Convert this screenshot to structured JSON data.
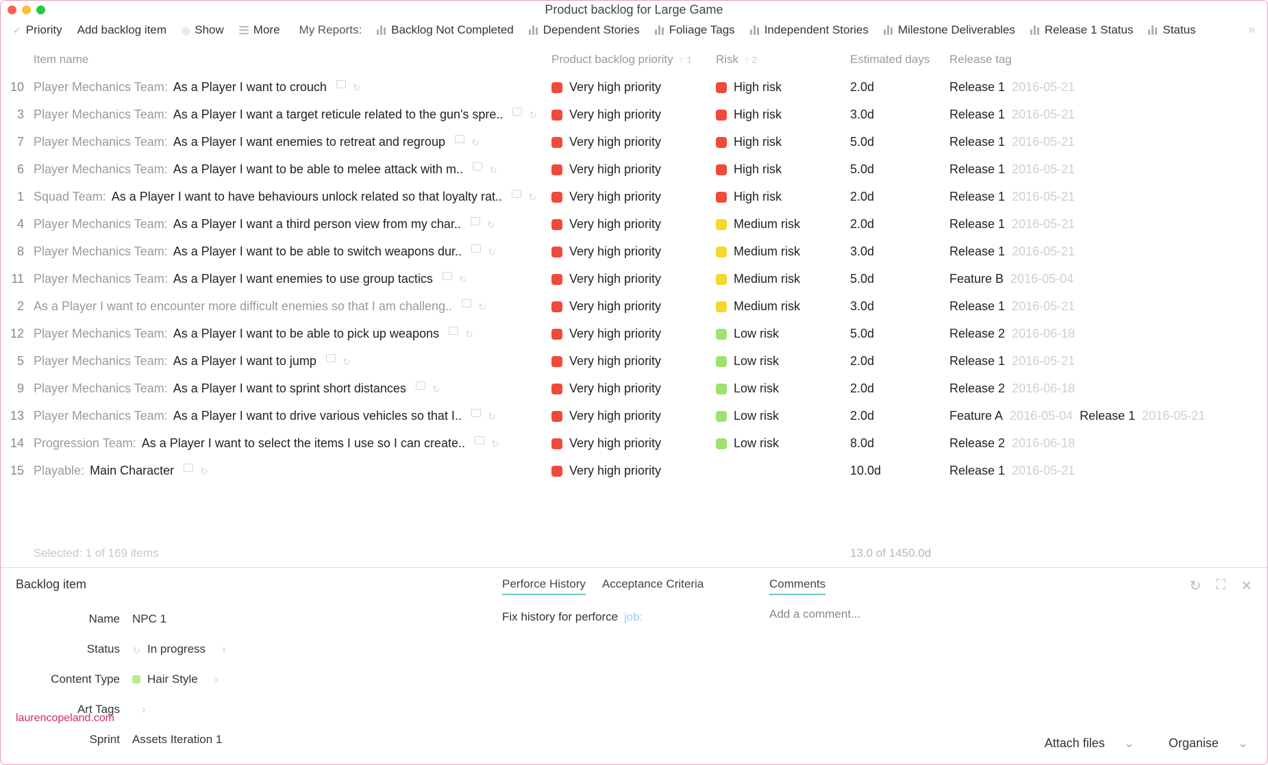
{
  "window_title": "Product backlog for Large Game",
  "toolbar": {
    "priority": "Priority",
    "add": "Add backlog item",
    "show": "Show",
    "more": "More",
    "my_reports": "My Reports:",
    "reports": [
      "Backlog Not Completed",
      "Dependent Stories",
      "Foliage Tags",
      "Independent Stories",
      "Milestone Deliverables",
      "Release 1 Status",
      "Status"
    ]
  },
  "columns": {
    "name": "Item name",
    "priority": "Product backlog priority",
    "priority_sort": "↑ 1",
    "risk": "Risk",
    "risk_sort": "↑ 2",
    "est": "Estimated days",
    "tag": "Release tag"
  },
  "rows": [
    {
      "id": "10",
      "team": "Player Mechanics Team:",
      "story": "As a Player I want to crouch",
      "priority": "Very high priority",
      "risk": "High risk",
      "riskc": "red",
      "est": "2.0d",
      "tags": [
        {
          "name": "Release 1",
          "date": "2016-05-21"
        }
      ]
    },
    {
      "id": "3",
      "team": "Player Mechanics Team:",
      "story": "As a Player I want a target reticule related to the gun's spre..",
      "priority": "Very high priority",
      "risk": "High risk",
      "riskc": "red",
      "est": "3.0d",
      "tags": [
        {
          "name": "Release 1",
          "date": "2016-05-21"
        }
      ]
    },
    {
      "id": "7",
      "team": "Player Mechanics Team:",
      "story": "As a Player I want enemies to retreat and regroup",
      "priority": "Very high priority",
      "risk": "High risk",
      "riskc": "red",
      "est": "5.0d",
      "tags": [
        {
          "name": "Release 1",
          "date": "2016-05-21"
        }
      ]
    },
    {
      "id": "6",
      "team": "Player Mechanics Team:",
      "story": "As a Player I want to be able to melee attack with m..",
      "priority": "Very high priority",
      "risk": "High risk",
      "riskc": "red",
      "est": "5.0d",
      "tags": [
        {
          "name": "Release 1",
          "date": "2016-05-21"
        }
      ]
    },
    {
      "id": "1",
      "team": "Squad Team:",
      "story": "As a Player I want to have behaviours unlock related so that loyalty rat..",
      "priority": "Very high priority",
      "risk": "High risk",
      "riskc": "red",
      "est": "2.0d",
      "tags": [
        {
          "name": "Release 1",
          "date": "2016-05-21"
        }
      ]
    },
    {
      "id": "4",
      "team": "Player Mechanics Team:",
      "story": "As a Player I want a third person view from my char..",
      "priority": "Very high priority",
      "risk": "Medium risk",
      "riskc": "yellow",
      "est": "2.0d",
      "tags": [
        {
          "name": "Release 1",
          "date": "2016-05-21"
        }
      ]
    },
    {
      "id": "8",
      "team": "Player Mechanics Team:",
      "story": "As a Player I want to be able to switch weapons dur..",
      "priority": "Very high priority",
      "risk": "Medium risk",
      "riskc": "yellow",
      "est": "3.0d",
      "tags": [
        {
          "name": "Release 1",
          "date": "2016-05-21"
        }
      ]
    },
    {
      "id": "11",
      "team": "Player Mechanics Team:",
      "story": "As a Player I want enemies to use group tactics",
      "priority": "Very high priority",
      "risk": "Medium risk",
      "riskc": "yellow",
      "est": "5.0d",
      "tags": [
        {
          "name": "Feature B",
          "date": "2016-05-04"
        }
      ]
    },
    {
      "id": "2",
      "team": "",
      "story": "As a Player I want to encounter more difficult enemies so that I am challeng..",
      "story_grey": true,
      "priority": "Very high priority",
      "risk": "Medium risk",
      "riskc": "yellow",
      "est": "3.0d",
      "tags": [
        {
          "name": "Release 1",
          "date": "2016-05-21"
        }
      ]
    },
    {
      "id": "12",
      "team": "Player Mechanics Team:",
      "story": "As a Player I want to be able to pick up weapons",
      "priority": "Very high priority",
      "risk": "Low risk",
      "riskc": "green",
      "est": "5.0d",
      "tags": [
        {
          "name": "Release 2",
          "date": "2016-06-18"
        }
      ]
    },
    {
      "id": "5",
      "team": "Player Mechanics Team:",
      "story": "As a Player I want to jump",
      "priority": "Very high priority",
      "risk": "Low risk",
      "riskc": "green",
      "est": "2.0d",
      "tags": [
        {
          "name": "Release 1",
          "date": "2016-05-21"
        }
      ]
    },
    {
      "id": "9",
      "team": "Player Mechanics Team:",
      "story": "As a Player I want to sprint short distances",
      "priority": "Very high priority",
      "risk": "Low risk",
      "riskc": "green",
      "est": "2.0d",
      "tags": [
        {
          "name": "Release 2",
          "date": "2016-06-18"
        }
      ]
    },
    {
      "id": "13",
      "team": "Player Mechanics Team:",
      "story": "As a Player I want to drive various vehicles so that I..",
      "priority": "Very high priority",
      "risk": "Low risk",
      "riskc": "green",
      "est": "2.0d",
      "tags": [
        {
          "name": "Feature A",
          "date": "2016-05-04"
        },
        {
          "name": "Release 1",
          "date": "2016-05-21"
        }
      ]
    },
    {
      "id": "14",
      "team": "Progression Team:",
      "story": "As a Player I want to select the items I use so I can create..",
      "priority": "Very high priority",
      "risk": "Low risk",
      "riskc": "green",
      "est": "8.0d",
      "tags": [
        {
          "name": "Release 2",
          "date": "2016-06-18"
        }
      ]
    },
    {
      "id": "15",
      "team": "Playable:",
      "story": "Main Character",
      "priority": "Very high priority",
      "risk": "",
      "riskc": "",
      "est": "10.0d",
      "tags": [
        {
          "name": "Release 1",
          "date": "2016-05-21"
        }
      ]
    }
  ],
  "footer": {
    "selected": "Selected: 1 of 169 items",
    "est_total": "13.0 of 1450.0d"
  },
  "detail": {
    "heading": "Backlog item",
    "name_lbl": "Name",
    "name_val": "NPC 1",
    "status_lbl": "Status",
    "status_val": "In progress",
    "ctype_lbl": "Content Type",
    "ctype_val": "Hair Style",
    "art_lbl": "Art Tags",
    "sprint_lbl": "Sprint",
    "sprint_val": "Assets Iteration 1",
    "tab_perforce": "Perforce History",
    "tab_acc": "Acceptance Criteria",
    "tab_comments": "Comments",
    "perforce_text": "Fix history for perforce",
    "perforce_link": "job:",
    "add_comment": "Add a comment...",
    "attach": "Attach files",
    "organise": "Organise"
  },
  "brand": "laurencopeland.com"
}
